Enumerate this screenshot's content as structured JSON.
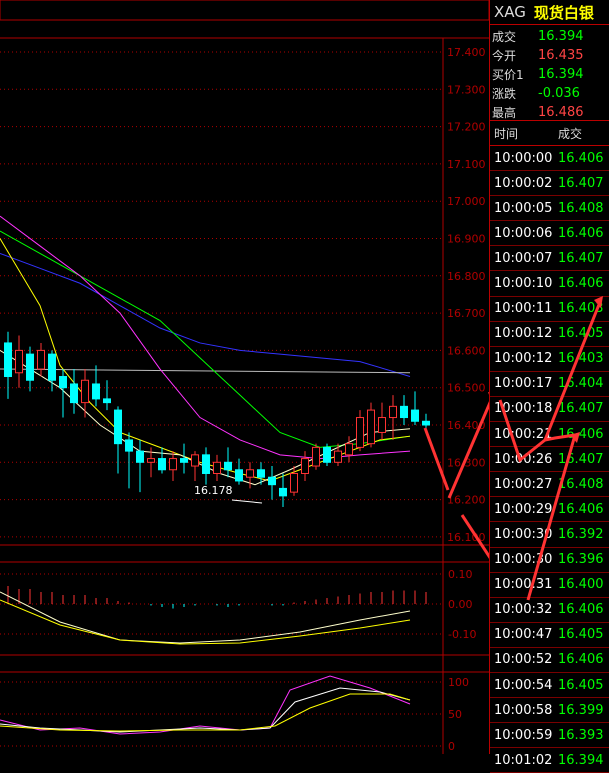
{
  "colors": {
    "up": "#ff3333",
    "down": "#00ffff",
    "grid": "#b00000",
    "ma5": "#ffffcc",
    "ma10": "#ffff00",
    "ma20": "#ff33ff",
    "ma30": "#00ff00",
    "ma60": "#3333ff",
    "ma120": "#bbbbbb",
    "green": "#00ff00",
    "red": "#ff4444",
    "annotation_arrow": "#ff3333"
  },
  "price_axis": {
    "ticks": [
      "17.400",
      "17.300",
      "17.200",
      "17.100",
      "17.000",
      "16.900",
      "16.800",
      "16.700",
      "16.600",
      "16.500",
      "16.400",
      "16.300",
      "16.200",
      "16.100"
    ]
  },
  "low_label": "16.178",
  "macd_axis": {
    "ticks": [
      "0.10",
      "0.00",
      "-0.10"
    ]
  },
  "kdj_axis": {
    "ticks": [
      "100",
      "50",
      "0"
    ]
  },
  "symbol": {
    "code": "XAG",
    "name": "现货白银"
  },
  "quotes": [
    {
      "label": "成交",
      "value": "16.394",
      "color": "green"
    },
    {
      "label": "今开",
      "value": "16.435",
      "color": "red"
    },
    {
      "label": "买价1",
      "value": "16.394",
      "color": "green"
    },
    {
      "label": "涨跌",
      "value": "-0.036",
      "color": "green"
    },
    {
      "label": "最高",
      "value": "16.486",
      "color": "red"
    }
  ],
  "ticks_header": {
    "time": "时间",
    "price": "成交"
  },
  "ticks": [
    {
      "time": "10:00:00",
      "price": "16.406"
    },
    {
      "time": "10:00:02",
      "price": "16.407"
    },
    {
      "time": "10:00:05",
      "price": "16.408"
    },
    {
      "time": "10:00:06",
      "price": "16.406"
    },
    {
      "time": "10:00:07",
      "price": "16.407"
    },
    {
      "time": "10:00:10",
      "price": "16.406"
    },
    {
      "time": "10:00:11",
      "price": "16.403"
    },
    {
      "time": "10:00:12",
      "price": "16.405"
    },
    {
      "time": "10:00:12",
      "price": "16.403"
    },
    {
      "time": "10:00:17",
      "price": "16.404"
    },
    {
      "time": "10:00:18",
      "price": "16.407"
    },
    {
      "time": "10:00:21",
      "price": "16.406"
    },
    {
      "time": "10:00:26",
      "price": "16.407"
    },
    {
      "time": "10:00:27",
      "price": "16.408"
    },
    {
      "time": "10:00:29",
      "price": "16.406"
    },
    {
      "time": "10:00:30",
      "price": "16.392"
    },
    {
      "time": "10:00:30",
      "price": "16.396"
    },
    {
      "time": "10:00:31",
      "price": "16.400"
    },
    {
      "time": "10:00:32",
      "price": "16.406"
    },
    {
      "time": "10:00:47",
      "price": "16.405"
    },
    {
      "time": "10:00:52",
      "price": "16.406"
    },
    {
      "time": "10:00:54",
      "price": "16.405"
    },
    {
      "time": "10:00:58",
      "price": "16.399"
    },
    {
      "time": "10:00:59",
      "price": "16.393"
    },
    {
      "time": "10:01:02",
      "price": "16.394"
    }
  ],
  "candles": [
    {
      "o": 16.62,
      "h": 16.65,
      "l": 16.47,
      "c": 16.53
    },
    {
      "o": 16.54,
      "h": 16.64,
      "l": 16.5,
      "c": 16.6
    },
    {
      "o": 16.59,
      "h": 16.61,
      "l": 16.49,
      "c": 16.52
    },
    {
      "o": 16.55,
      "h": 16.62,
      "l": 16.53,
      "c": 16.6
    },
    {
      "o": 16.59,
      "h": 16.6,
      "l": 16.49,
      "c": 16.52
    },
    {
      "o": 16.53,
      "h": 16.55,
      "l": 16.42,
      "c": 16.5
    },
    {
      "o": 16.51,
      "h": 16.55,
      "l": 16.43,
      "c": 16.46
    },
    {
      "o": 16.46,
      "h": 16.55,
      "l": 16.42,
      "c": 16.52
    },
    {
      "o": 16.51,
      "h": 16.56,
      "l": 16.45,
      "c": 16.47
    },
    {
      "o": 16.47,
      "h": 16.52,
      "l": 16.44,
      "c": 16.46
    },
    {
      "o": 16.44,
      "h": 16.45,
      "l": 16.27,
      "c": 16.35
    },
    {
      "o": 16.36,
      "h": 16.38,
      "l": 16.23,
      "c": 16.33
    },
    {
      "o": 16.33,
      "h": 16.36,
      "l": 16.22,
      "c": 16.3
    },
    {
      "o": 16.3,
      "h": 16.34,
      "l": 16.26,
      "c": 16.31
    },
    {
      "o": 16.31,
      "h": 16.34,
      "l": 16.27,
      "c": 16.28
    },
    {
      "o": 16.28,
      "h": 16.33,
      "l": 16.25,
      "c": 16.31
    },
    {
      "o": 16.31,
      "h": 16.35,
      "l": 16.27,
      "c": 16.3
    },
    {
      "o": 16.29,
      "h": 16.33,
      "l": 16.25,
      "c": 16.32
    },
    {
      "o": 16.32,
      "h": 16.34,
      "l": 16.24,
      "c": 16.27
    },
    {
      "o": 16.27,
      "h": 16.32,
      "l": 16.25,
      "c": 16.3
    },
    {
      "o": 16.3,
      "h": 16.34,
      "l": 16.26,
      "c": 16.28
    },
    {
      "o": 16.28,
      "h": 16.31,
      "l": 16.24,
      "c": 16.25
    },
    {
      "o": 16.26,
      "h": 16.3,
      "l": 16.23,
      "c": 16.28
    },
    {
      "o": 16.28,
      "h": 16.3,
      "l": 16.24,
      "c": 16.26
    },
    {
      "o": 16.26,
      "h": 16.29,
      "l": 16.2,
      "c": 16.24
    },
    {
      "o": 16.23,
      "h": 16.27,
      "l": 16.18,
      "c": 16.21
    },
    {
      "o": 16.22,
      "h": 16.29,
      "l": 16.21,
      "c": 16.27
    },
    {
      "o": 16.27,
      "h": 16.33,
      "l": 16.25,
      "c": 16.31
    },
    {
      "o": 16.29,
      "h": 16.35,
      "l": 16.28,
      "c": 16.34
    },
    {
      "o": 16.34,
      "h": 16.35,
      "l": 16.29,
      "c": 16.3
    },
    {
      "o": 16.3,
      "h": 16.35,
      "l": 16.29,
      "c": 16.33
    },
    {
      "o": 16.32,
      "h": 16.37,
      "l": 16.3,
      "c": 16.35
    },
    {
      "o": 16.34,
      "h": 16.44,
      "l": 16.33,
      "c": 16.42
    },
    {
      "o": 16.35,
      "h": 16.46,
      "l": 16.34,
      "c": 16.44
    },
    {
      "o": 16.38,
      "h": 16.46,
      "l": 16.36,
      "c": 16.42
    },
    {
      "o": 16.42,
      "h": 16.48,
      "l": 16.36,
      "c": 16.45
    },
    {
      "o": 16.45,
      "h": 16.48,
      "l": 16.4,
      "c": 16.42
    },
    {
      "o": 16.44,
      "h": 16.49,
      "l": 16.4,
      "c": 16.41
    },
    {
      "o": 16.41,
      "h": 16.43,
      "l": 16.39,
      "c": 16.4
    }
  ],
  "macd_hist": [
    0.06,
    0.05,
    0.05,
    0.04,
    0.04,
    0.03,
    0.03,
    0.03,
    0.02,
    0.02,
    0.01,
    0.005,
    0.0,
    -0.005,
    -0.01,
    -0.015,
    -0.01,
    -0.005,
    0.0,
    -0.005,
    -0.01,
    -0.005,
    0.0,
    0.0,
    -0.005,
    -0.005,
    0.005,
    0.01,
    0.015,
    0.02,
    0.025,
    0.03,
    0.035,
    0.04,
    0.04,
    0.045,
    0.045,
    0.045,
    0.04
  ]
}
